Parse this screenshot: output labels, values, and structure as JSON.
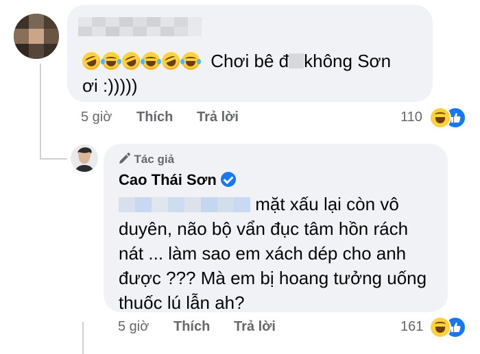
{
  "comment": {
    "text_suffix": "không Sơn",
    "text_prefix": "Chơi bê đ",
    "text_line2": "ơi :)))))",
    "time": "5 giờ",
    "like_label": "Thích",
    "reply_label": "Trả lời",
    "reaction_count": "110",
    "reaction_icons": [
      "haha-icon",
      "like-icon"
    ]
  },
  "reply": {
    "author_tag": "Tác giả",
    "author_name": "Cao Thái Sơn",
    "line1_suffix": "mặt xấu lại còn vô",
    "line2": "duyên, não bộ vẩn đục tâm hồn rách",
    "line3": "nát ... làm sao em xách dép cho anh",
    "line4": "được ??? Mà em bị hoang tưởng uống",
    "line5": "thuốc lú lẫn ah?",
    "time": "5 giờ",
    "like_label": "Thích",
    "reply_label": "Trả lời",
    "reaction_count": "161",
    "reaction_icons": [
      "haha-icon",
      "like-icon"
    ]
  },
  "colors": {
    "bubble": "#f0f2f5",
    "meta_text": "#65676b",
    "like_blue": "#1877f2",
    "haha_yellow": "#ffd23c"
  }
}
